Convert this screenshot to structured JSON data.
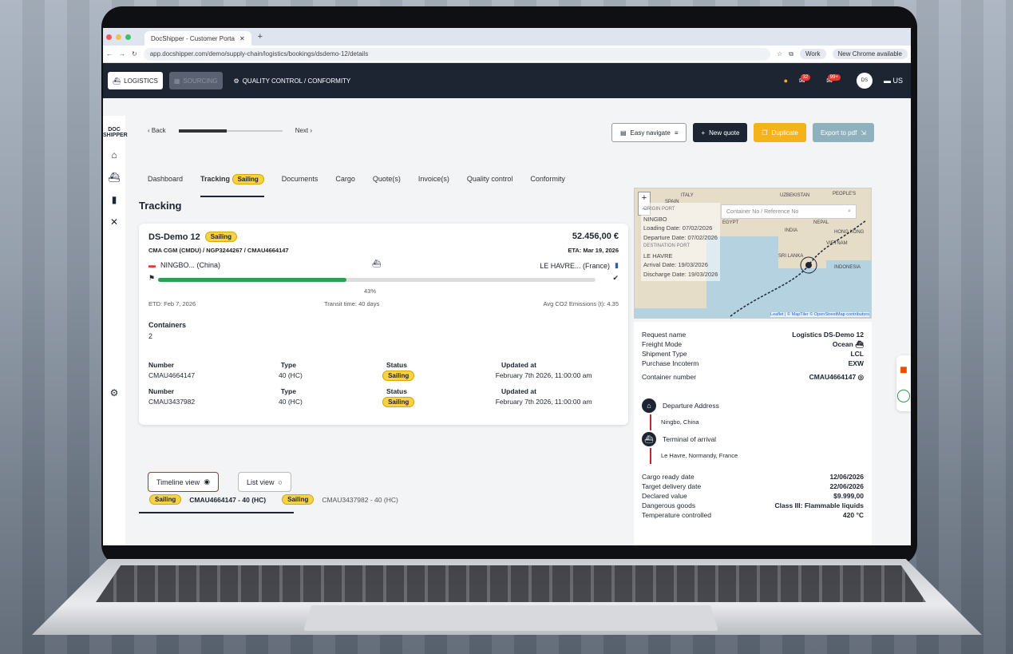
{
  "browser": {
    "tab_title": "DocShipper - Customer Porta",
    "url": "app.docshipper.com/demo/supply-chain/logistics/bookings/dsdemo-12/details",
    "profile": "Work",
    "update": "New Chrome available"
  },
  "header": {
    "logistics": "LOGISTICS",
    "sourcing": "SOURCING",
    "quality": "QUALITY CONTROL / CONFORMITY",
    "cart_badge": "32",
    "msg_badge": "99+",
    "lang": "US"
  },
  "sidebar": {
    "logo": "DOC SHIPPER"
  },
  "nav": {
    "back": "Back",
    "next": "Next",
    "easy": "Easy navigate",
    "new_quote": "New quote",
    "duplicate": "Duplicate",
    "export": "Export to pdf"
  },
  "tabs": [
    {
      "label": "Dashboard"
    },
    {
      "label": "Tracking",
      "badge": "Sailing"
    },
    {
      "label": "Documents"
    },
    {
      "label": "Cargo"
    },
    {
      "label": "Quote(s)"
    },
    {
      "label": "Invoice(s)"
    },
    {
      "label": "Quality control"
    },
    {
      "label": "Conformity"
    }
  ],
  "page_title": "Tracking",
  "shipment": {
    "name": "DS-Demo 12",
    "status": "Sailing",
    "price": "52.456,00 €",
    "refs": "CMA CGM (CMDU) / NGP3244267 / CMAU4664147",
    "eta": "ETA: Mar 19, 2026",
    "origin": "NINGBO... (China)",
    "destination": "LE HAVRE... (France)",
    "progress": 0.43,
    "progress_label": "43%",
    "etd": "ETD: Feb 7, 2026",
    "transit": "Transit time: 40 days",
    "co2": "Avg CO2 Emissions (t): 4.35",
    "containers_label": "Containers",
    "containers_count": "2"
  },
  "table": {
    "headers": [
      "Number",
      "Type",
      "Status",
      "Updated at"
    ],
    "rows": [
      {
        "number": "CMAU4664147",
        "type": "40 (HC)",
        "status": "Sailing",
        "updated": "February 7th 2026, 11:00:00 am"
      },
      {
        "number": "CMAU3437982",
        "type": "40 (HC)",
        "status": "Sailing",
        "updated": "February 7th 2026, 11:00:00 am"
      }
    ]
  },
  "views": {
    "timeline": "Timeline view",
    "list": "List view"
  },
  "bottom": [
    {
      "status": "Sailing",
      "label": "CMAU4664147 - 40 (HC)"
    },
    {
      "status": "Sailing",
      "label": "CMAU3437982 - 40 (HC)"
    }
  ],
  "map": {
    "search_placeholder": "Container No / Reference No",
    "lines": [
      "ORIGIN PORT",
      "NINGBO",
      "Loading Date: 07/02/2026",
      "Departure Date: 07/02/2026",
      "DESTINATION PORT",
      "LE HAVRE",
      "Arrival Date: 19/03/2026",
      "Discharge Date: 19/03/2026"
    ],
    "labels": [
      "ITALY",
      "UZBEKISTAN",
      "PEOPLE'S",
      "INDIA",
      "NEPAL",
      "HONG KONG",
      "VIETNAM",
      "SRI LANKA",
      "INDONESIA",
      "EGYPT",
      "SPAIN"
    ],
    "attrib": "Leaflet | © MapTiler © OpenStreetMap contributors"
  },
  "details": [
    {
      "k": "Request name",
      "v": "Logistics DS-Demo 12"
    },
    {
      "k": "Freight Mode",
      "v": "Ocean"
    },
    {
      "k": "Shipment Type",
      "v": "LCL"
    },
    {
      "k": "Purchase Incoterm",
      "v": "EXW"
    },
    {
      "k": "Container number",
      "v": "CMAU4664147"
    }
  ],
  "addresses": {
    "departure_label": "Departure Address",
    "departure": "Ningbo, China",
    "arrival_label": "Terminal of arrival",
    "arrival": "Le Havre, Normandy, France"
  },
  "more": [
    {
      "k": "Cargo ready date",
      "v": "12/06/2026"
    },
    {
      "k": "Target delivery date",
      "v": "22/06/2026"
    },
    {
      "k": "Declared value",
      "v": "$9.999,00"
    },
    {
      "k": "Dangerous goods",
      "v": "Class III: Flammable liquids"
    },
    {
      "k": "Temperature controlled",
      "v": "420 °C"
    }
  ]
}
